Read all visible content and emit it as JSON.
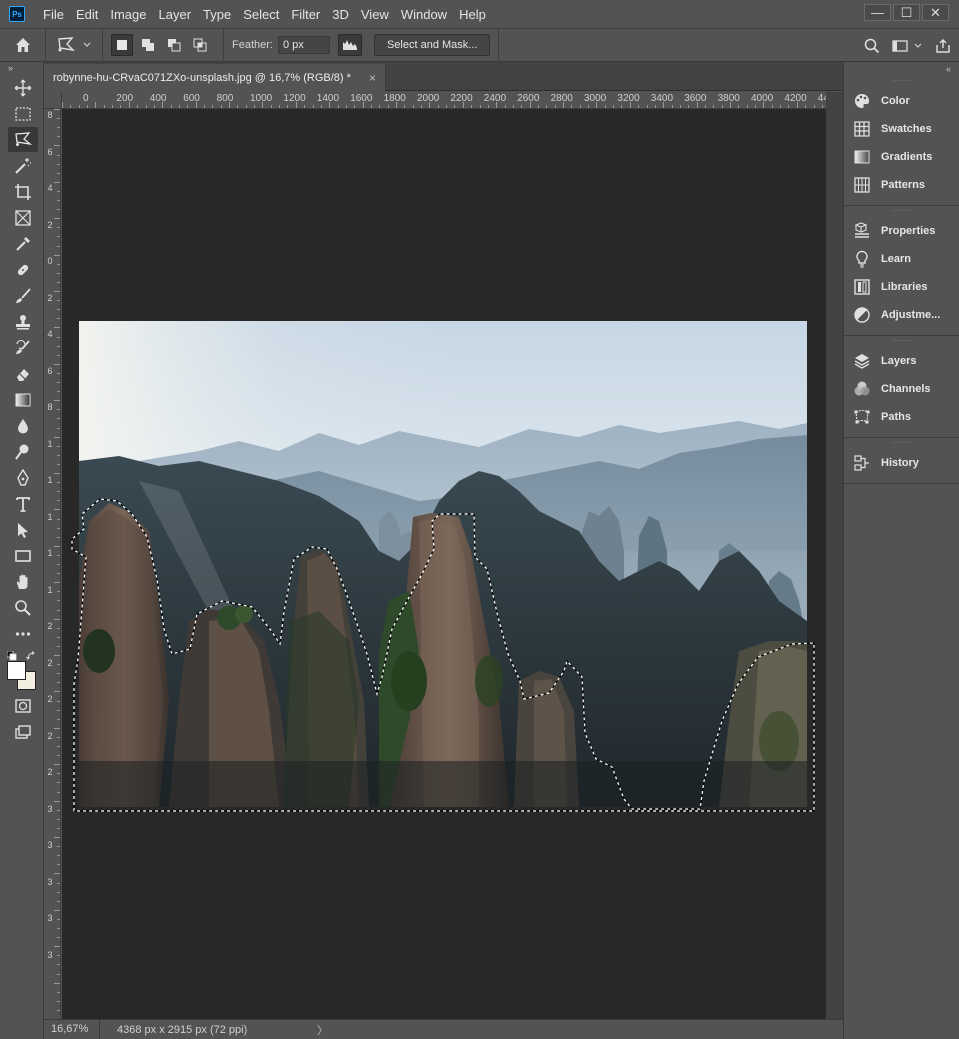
{
  "app": {
    "logo_text": "Ps"
  },
  "menu": [
    "File",
    "Edit",
    "Image",
    "Layer",
    "Type",
    "Select",
    "Filter",
    "3D",
    "View",
    "Window",
    "Help"
  ],
  "window_controls": {
    "minimize": "—",
    "maximize": "☐",
    "close": "✕"
  },
  "options": {
    "feather_label": "Feather:",
    "feather_value": "0 px",
    "select_and_mask": "Select and Mask..."
  },
  "document": {
    "tab_title": "robynne-hu-CRvaC071ZXo-unsplash.jpg @ 16,7% (RGB/8) *",
    "close": "×"
  },
  "ruler_h": [
    "0",
    "200",
    "400",
    "600",
    "800",
    "1000",
    "1200",
    "1400",
    "1600",
    "1800",
    "2000",
    "2200",
    "2400",
    "2600",
    "2800",
    "3000",
    "3200",
    "3400",
    "3600",
    "3800",
    "4000",
    "4200",
    "44"
  ],
  "ruler_v": [
    "8",
    "6",
    "4",
    "2",
    "0",
    "2",
    "4",
    "6",
    "8",
    "1",
    "1",
    "1",
    "1",
    "1",
    "2",
    "2",
    "2",
    "2",
    "2",
    "3",
    "3",
    "3",
    "3",
    "3"
  ],
  "status": {
    "zoom": "16,67%",
    "info": "4368 px x 2915 px (72 ppi)",
    "arrow": "〉"
  },
  "tools": [
    "move-tool",
    "marquee-tool",
    "polygonal-lasso-tool",
    "magic-wand-tool",
    "crop-tool",
    "frame-tool",
    "eyedropper-tool",
    "healing-brush-tool",
    "brush-tool",
    "clone-stamp-tool",
    "history-brush-tool",
    "eraser-tool",
    "gradient-tool",
    "blur-tool",
    "dodge-tool",
    "pen-tool",
    "type-tool",
    "path-selection-tool",
    "rectangle-tool",
    "hand-tool",
    "zoom-tool",
    "more-tools"
  ],
  "panels": {
    "group1": [
      {
        "id": "color",
        "label": "Color"
      },
      {
        "id": "swatches",
        "label": "Swatches"
      },
      {
        "id": "gradients",
        "label": "Gradients"
      },
      {
        "id": "patterns",
        "label": "Patterns"
      }
    ],
    "group2": [
      {
        "id": "properties",
        "label": "Properties"
      },
      {
        "id": "learn",
        "label": "Learn"
      },
      {
        "id": "libraries",
        "label": "Libraries"
      },
      {
        "id": "adjustments",
        "label": "Adjustme..."
      }
    ],
    "group3": [
      {
        "id": "layers",
        "label": "Layers"
      },
      {
        "id": "channels",
        "label": "Channels"
      },
      {
        "id": "paths",
        "label": "Paths"
      }
    ],
    "group4": [
      {
        "id": "history",
        "label": "History"
      }
    ]
  },
  "colors": {
    "ui_bg": "#535353",
    "canvas_bg": "#282828",
    "foreground": "#ffffff",
    "background": "#f2efe0"
  }
}
